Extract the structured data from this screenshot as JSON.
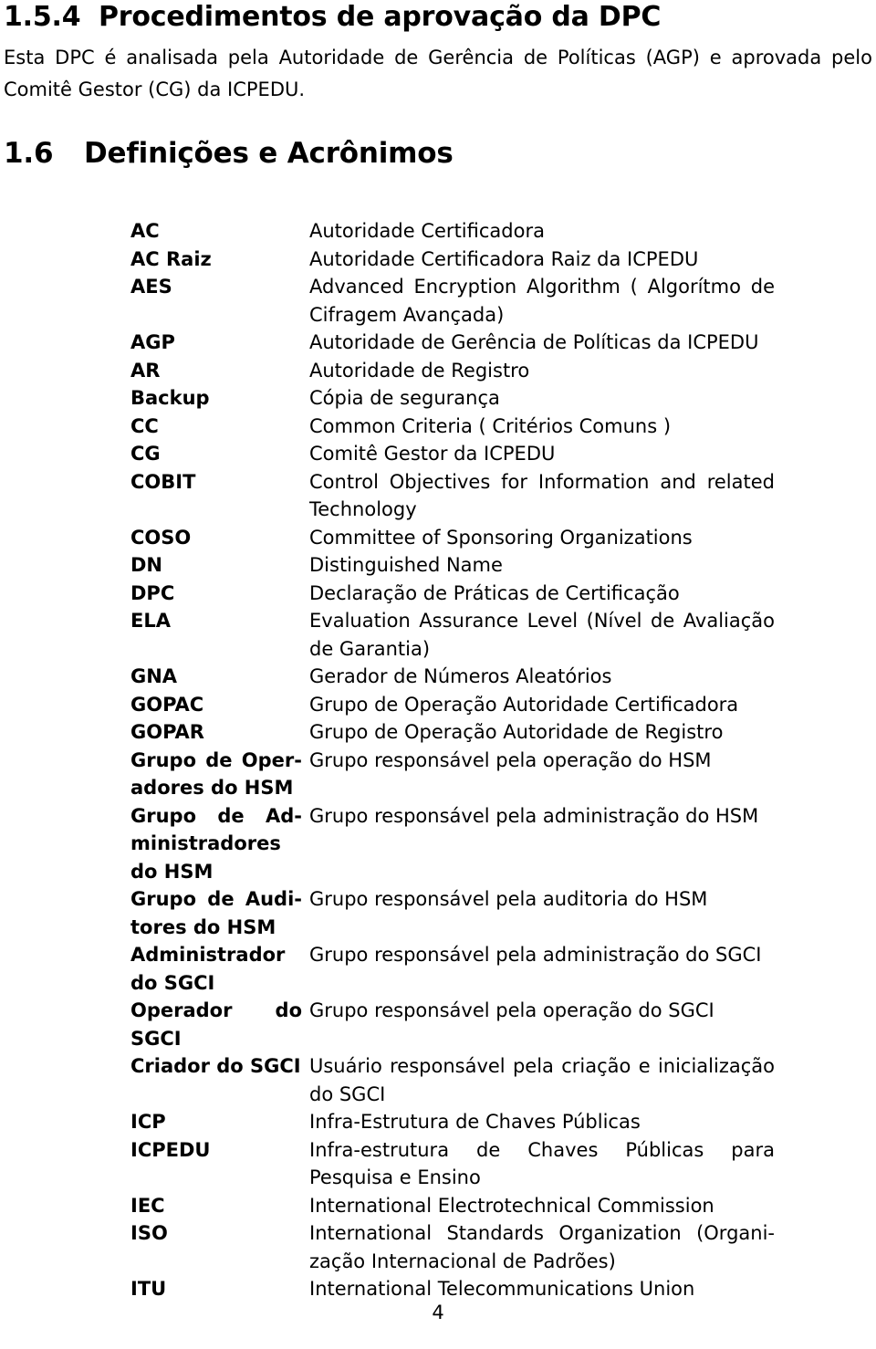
{
  "document": {
    "subsection": {
      "number": "1.5.4",
      "title": "Procedimentos de aprovação da DPC",
      "paragraph": "Esta DPC é analisada pela Autoridade de Gerência de Políticas (AGP) e aprovada pelo Comitê Gestor (CG) da ICPEDU."
    },
    "section": {
      "number": "1.6",
      "title": "Definições e Acrônimos"
    },
    "definitions": [
      {
        "term": "AC",
        "description": "Autoridade Certificadora"
      },
      {
        "term": "AC Raiz",
        "description": "Autoridade Certificadora Raiz da ICPEDU"
      },
      {
        "term": "AES",
        "description": "Advanced Encryption Algorithm ( Algorítmo de Cifragem Avançada)"
      },
      {
        "term": "AGP",
        "description": "Autoridade de Gerência de Políticas da ICPEDU"
      },
      {
        "term": "AR",
        "description": "Autoridade de Registro"
      },
      {
        "term": "Backup",
        "description": "Cópia de segurança"
      },
      {
        "term": "CC",
        "description": "Common Criteria ( Critérios Comuns )"
      },
      {
        "term": "CG",
        "description": "Comitê Gestor da ICPEDU"
      },
      {
        "term": "COBIT",
        "description": "Control Objectives for Information and related Technology"
      },
      {
        "term": "COSO",
        "description": "Committee of Sponsoring Organizations"
      },
      {
        "term": "DN",
        "description": "Distinguished Name"
      },
      {
        "term": "DPC",
        "description": "Declaração de Práticas de Certificação"
      },
      {
        "term": "ELA",
        "description": "Evaluation Assurance Level (Nível de Avaliação de Garantia)"
      },
      {
        "term": "GNA",
        "description": "Gerador de Números Aleatórios"
      },
      {
        "term": "GOPAC",
        "description": "Grupo de Operação Autoridade Certificadora"
      },
      {
        "term": "GOPAR",
        "description": "Grupo de Operação Autoridade de Registro"
      },
      {
        "term": "Grupo de Oper­adores do HSM",
        "description": "Grupo responsável pela operação do HSM"
      },
      {
        "term": "Grupo de Ad­ministradores do HSM",
        "description": "Grupo responsável pela administração do HSM"
      },
      {
        "term": "Grupo de Audi­tores do HSM",
        "description": "Grupo responsável pela auditoria do HSM"
      },
      {
        "term": "Administrador do SGCI",
        "description": "Grupo responsável pela administração do SGCI"
      },
      {
        "term": "Operador do SGCI",
        "description": "Grupo responsável pela operação do SGCI"
      },
      {
        "term": "Criador do SGCI",
        "description": "Usuário responsável pela criação e inicialização do SGCI"
      },
      {
        "term": "ICP",
        "description": "Infra-Estrutura de Chaves Públicas"
      },
      {
        "term": "ICPEDU",
        "description": "Infra-estrutura de Chaves Públicas para Pesquisa e Ensino"
      },
      {
        "term": "IEC",
        "description": "International Electrotechnical Commission"
      },
      {
        "term": "ISO",
        "description": "International Standards Organization (Organi­zação Internacional de Padrões)"
      },
      {
        "term": "ITU",
        "description": "International Telecommunications Union"
      }
    ],
    "page_number": "4"
  }
}
